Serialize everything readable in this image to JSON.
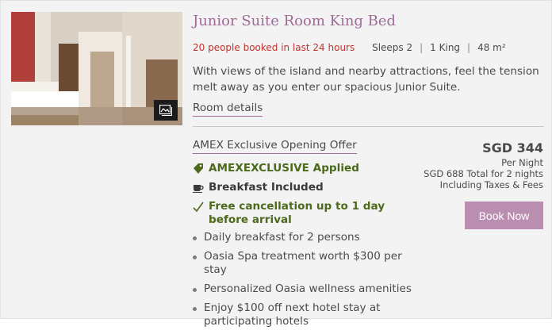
{
  "room": {
    "title": "Junior Suite Room King Bed",
    "booked": "20 people booked in last 24 hours",
    "sleeps": "Sleeps 2",
    "bed": "1 King",
    "size": "48 m²",
    "description": "With views of the island and nearby attractions, feel the tension melt away as you enter our spacious Junior Suite.",
    "details_link": "Room details",
    "photo_icon": "gallery-icon"
  },
  "offer": {
    "title": "AMEX Exclusive Opening Offer",
    "features": [
      {
        "icon": "tag-icon",
        "label": "AMEXEXCLUSIVE Applied"
      },
      {
        "icon": "coffee-cup-icon",
        "label": "Breakfast Included"
      },
      {
        "icon": "checkmark-icon",
        "label": "Free cancellation up to 1 day before arrival"
      }
    ],
    "inclusions": [
      "Daily breakfast for 2 persons",
      "Oasia Spa treatment worth $300 per stay",
      "Personalized Oasia wellness amenities",
      "Enjoy $100 off next hotel stay at participating hotels"
    ]
  },
  "pricing": {
    "price": "SGD 344",
    "per": "Per Night",
    "total": "SGD 688 Total for 2 nights",
    "taxes": "Including Taxes & Fees",
    "book_label": "Book Now"
  },
  "colors": {
    "accent": "#a06a97",
    "button": "#b98eb0",
    "green": "#4b6a1b",
    "alert": "#c0332f"
  }
}
